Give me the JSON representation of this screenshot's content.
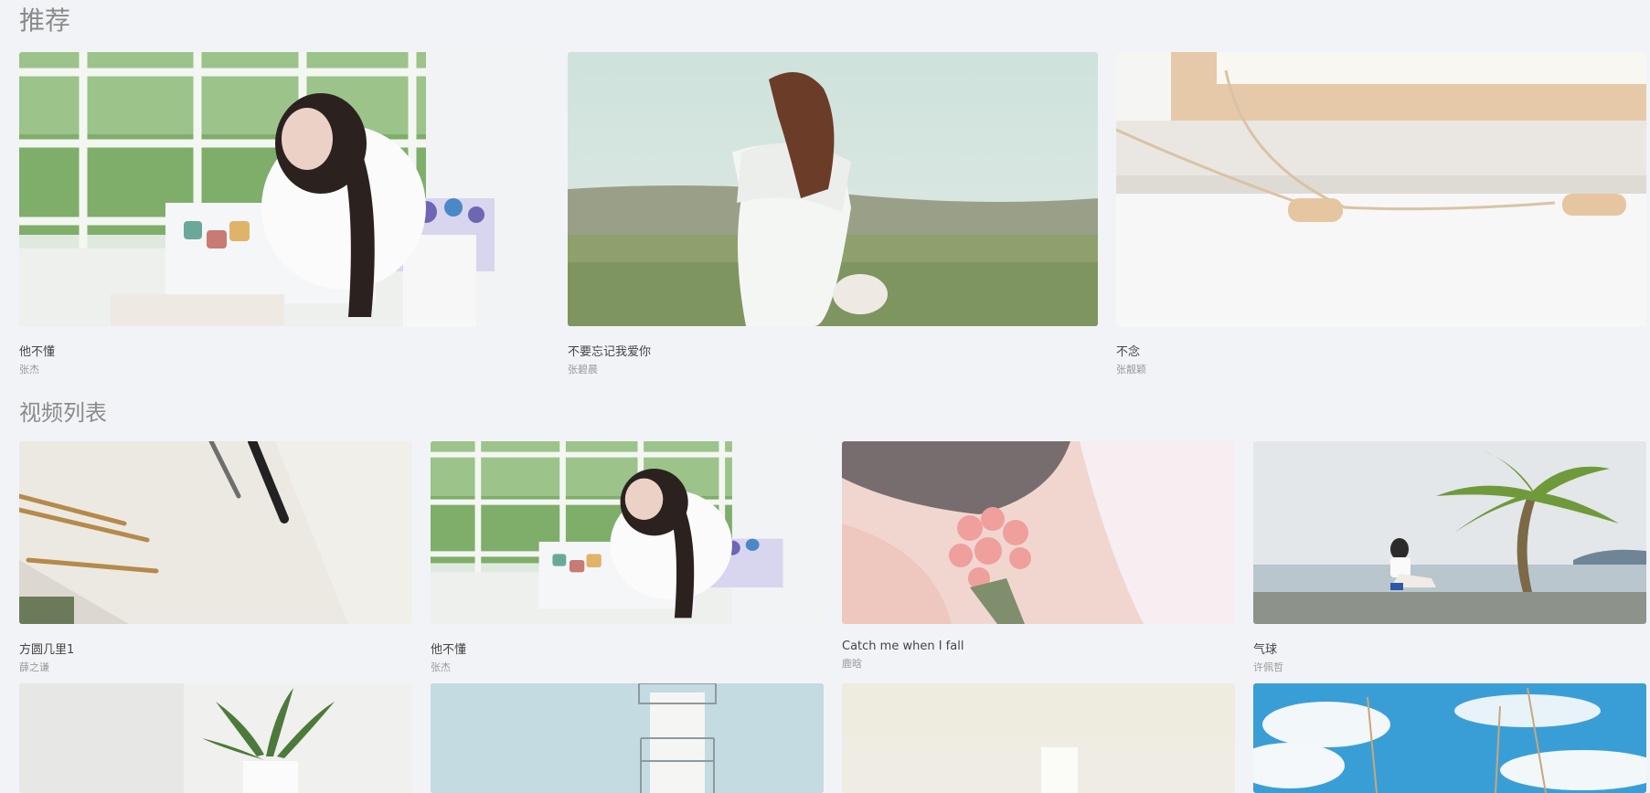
{
  "recommend": {
    "heading": "推荐",
    "items": [
      {
        "title": "他不懂",
        "artist": "张杰",
        "image": "girl-painting-window-photo"
      },
      {
        "title": "不要忘记我爱你",
        "artist": "张碧晨",
        "image": "girl-white-dress-meadow-photo"
      },
      {
        "title": "不念",
        "artist": "张靓颖",
        "image": "windowsill-wooden-toggle-photo"
      }
    ]
  },
  "videos": {
    "heading": "视频列表",
    "items": [
      {
        "title": "方圆几里1",
        "artist": "薛之谦",
        "image": "pencils-paper-photo"
      },
      {
        "title": "他不懂",
        "artist": "张杰",
        "image": "girl-painting-window-photo"
      },
      {
        "title": "Catch me when I fall",
        "artist": "鹿晗",
        "image": "pink-roses-photo"
      },
      {
        "title": "气球",
        "artist": "许佩哲",
        "image": "girl-seawall-palm-photo"
      }
    ],
    "partial_items": [
      {
        "image": "potted-plant-photo"
      },
      {
        "image": "lighthouse-photo"
      },
      {
        "image": "cream-room-photo"
      },
      {
        "image": "blue-sky-reeds-photo"
      }
    ]
  }
}
